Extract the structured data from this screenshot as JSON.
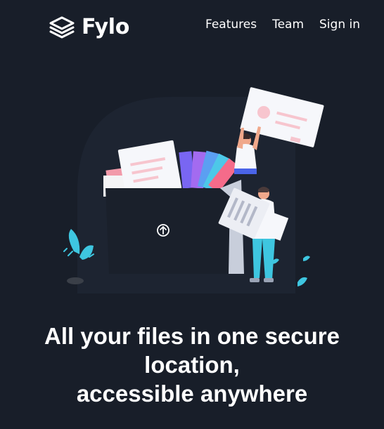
{
  "brand": {
    "name": "Fylo",
    "icon": "stacked-layers-icon"
  },
  "nav": {
    "items": [
      {
        "label": "Features"
      },
      {
        "label": "Team"
      },
      {
        "label": "Sign in"
      }
    ]
  },
  "hero": {
    "illustration_icon": "upload-arrow-icon",
    "headline_lines": [
      "All your files in one secure",
      "location,",
      "accessible anywhere"
    ]
  },
  "colors": {
    "background": "#181e29",
    "text": "#ffffff",
    "folder": "#1a202b",
    "accent_cyan": "#3ec6e0",
    "accent_pink": "#f7a6b6"
  }
}
